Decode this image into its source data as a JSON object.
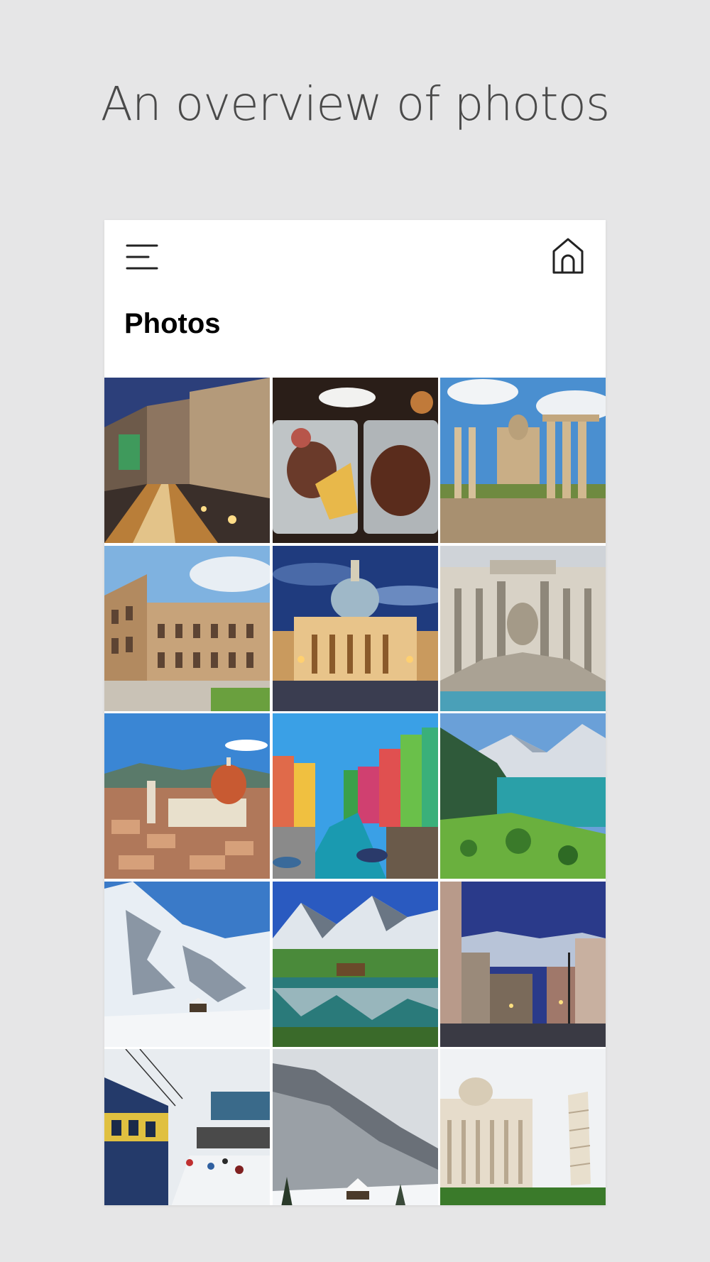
{
  "headline": "An overview of photos",
  "screen": {
    "title": "Photos",
    "menu_icon": "hamburger-menu-icon",
    "home_icon": "home-icon"
  },
  "photos": [
    {
      "name": "photo-rome-street-night"
    },
    {
      "name": "photo-food-platter"
    },
    {
      "name": "photo-roman-forum"
    },
    {
      "name": "photo-colosseum"
    },
    {
      "name": "photo-st-peters-basilica"
    },
    {
      "name": "photo-trevi-fountain"
    },
    {
      "name": "photo-florence-duomo"
    },
    {
      "name": "photo-burano-canal"
    },
    {
      "name": "photo-swiss-lake"
    },
    {
      "name": "photo-snowy-peaks"
    },
    {
      "name": "photo-alpine-lake-reflection"
    },
    {
      "name": "photo-mountain-town-dusk"
    },
    {
      "name": "photo-snow-train-station"
    },
    {
      "name": "photo-snowy-forest-village"
    },
    {
      "name": "photo-pisa-tower"
    }
  ]
}
